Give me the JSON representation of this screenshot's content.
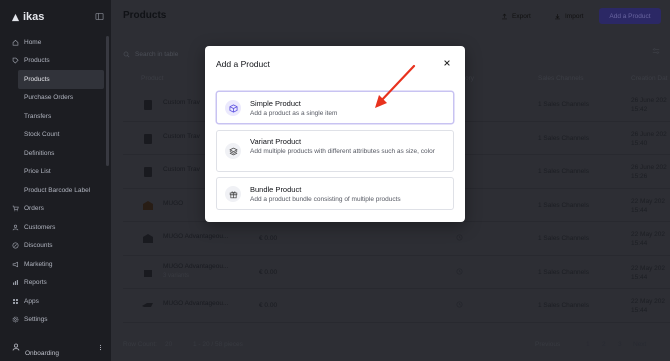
{
  "brand": {
    "name": "ikas"
  },
  "sidebar": {
    "items": [
      {
        "label": "Home",
        "icon": "home-icon"
      },
      {
        "label": "Products",
        "icon": "tag-icon"
      },
      {
        "label": "Products",
        "sub": true,
        "active": true
      },
      {
        "label": "Purchase Orders",
        "sub": true
      },
      {
        "label": "Transfers",
        "sub": true
      },
      {
        "label": "Stock Count",
        "sub": true
      },
      {
        "label": "Definitions",
        "sub": true
      },
      {
        "label": "Price List",
        "sub": true
      },
      {
        "label": "Product Barcode Label",
        "sub": true
      },
      {
        "label": "Orders",
        "icon": "cart-icon"
      },
      {
        "label": "Customers",
        "icon": "users-icon"
      },
      {
        "label": "Discounts",
        "icon": "discount-icon"
      },
      {
        "label": "Marketing",
        "icon": "megaphone-icon"
      },
      {
        "label": "Reports",
        "icon": "chart-icon"
      },
      {
        "label": "Apps",
        "icon": "apps-icon"
      },
      {
        "label": "Settings",
        "icon": "gear-icon"
      }
    ],
    "user": {
      "name": "Onboarding"
    }
  },
  "header": {
    "title": "Products",
    "export_label": "Export",
    "import_label": "Import",
    "add_label": "Add a Product"
  },
  "search": {
    "placeholder": "Search in table"
  },
  "table": {
    "columns": {
      "product": "Product",
      "category": "ory",
      "channels": "Sales Channels",
      "created": "Creation Dat"
    },
    "rows": [
      {
        "name": "Custom Trav",
        "variants": "",
        "price": "",
        "channels": "1 Sales Channels",
        "date": "26 June 202",
        "time": "15:42"
      },
      {
        "name": "Custom Trav",
        "variants": "",
        "price": "",
        "channels": "1 Sales Channels",
        "date": "26 June 202",
        "time": "15:40"
      },
      {
        "name": "Custom Trav",
        "variants": "",
        "price": "",
        "channels": "1 Sales Channels",
        "date": "26 June 202",
        "time": "15:26"
      },
      {
        "name": "MUGO",
        "variants": "",
        "price": "",
        "channels": "1 Sales Channels",
        "date": "22 May 202",
        "time": "15:44"
      },
      {
        "name": "MUGO Advantageou...",
        "variants": "",
        "price": "€ 0.00",
        "channels": "1 Sales Channels",
        "date": "22 May 202",
        "time": "15:44"
      },
      {
        "name": "MUGO Advantageou...",
        "variants": "3 variants",
        "price": "€ 0.00",
        "channels": "1 Sales Channels",
        "date": "22 May 202",
        "time": "15:44"
      },
      {
        "name": "MUGO Advantageou...",
        "variants": "",
        "price": "€ 0.00",
        "channels": "1 Sales Channels",
        "date": "22 May 202",
        "time": "15:44"
      }
    ]
  },
  "footer": {
    "row_count_label": "Row Count:",
    "row_count_value": "20",
    "range": "1 - 20 / 58 pieces",
    "previous": "Previous",
    "pages": [
      "1",
      "2",
      "3"
    ],
    "next": "Next"
  },
  "modal": {
    "title": "Add a Product",
    "options": [
      {
        "title": "Simple Product",
        "description": "Add a product as a single item",
        "icon": "box-icon"
      },
      {
        "title": "Variant Product",
        "description": "Add multiple products with different attributes such as size, color",
        "icon": "layers-icon"
      },
      {
        "title": "Bundle Product",
        "description": "Add a product bundle consisting of multiple products",
        "icon": "gift-icon"
      }
    ]
  },
  "colors": {
    "accent": "#5b4fe0",
    "annotation_arrow": "#e8321e",
    "sidebar_bg": "#1d1e23"
  }
}
